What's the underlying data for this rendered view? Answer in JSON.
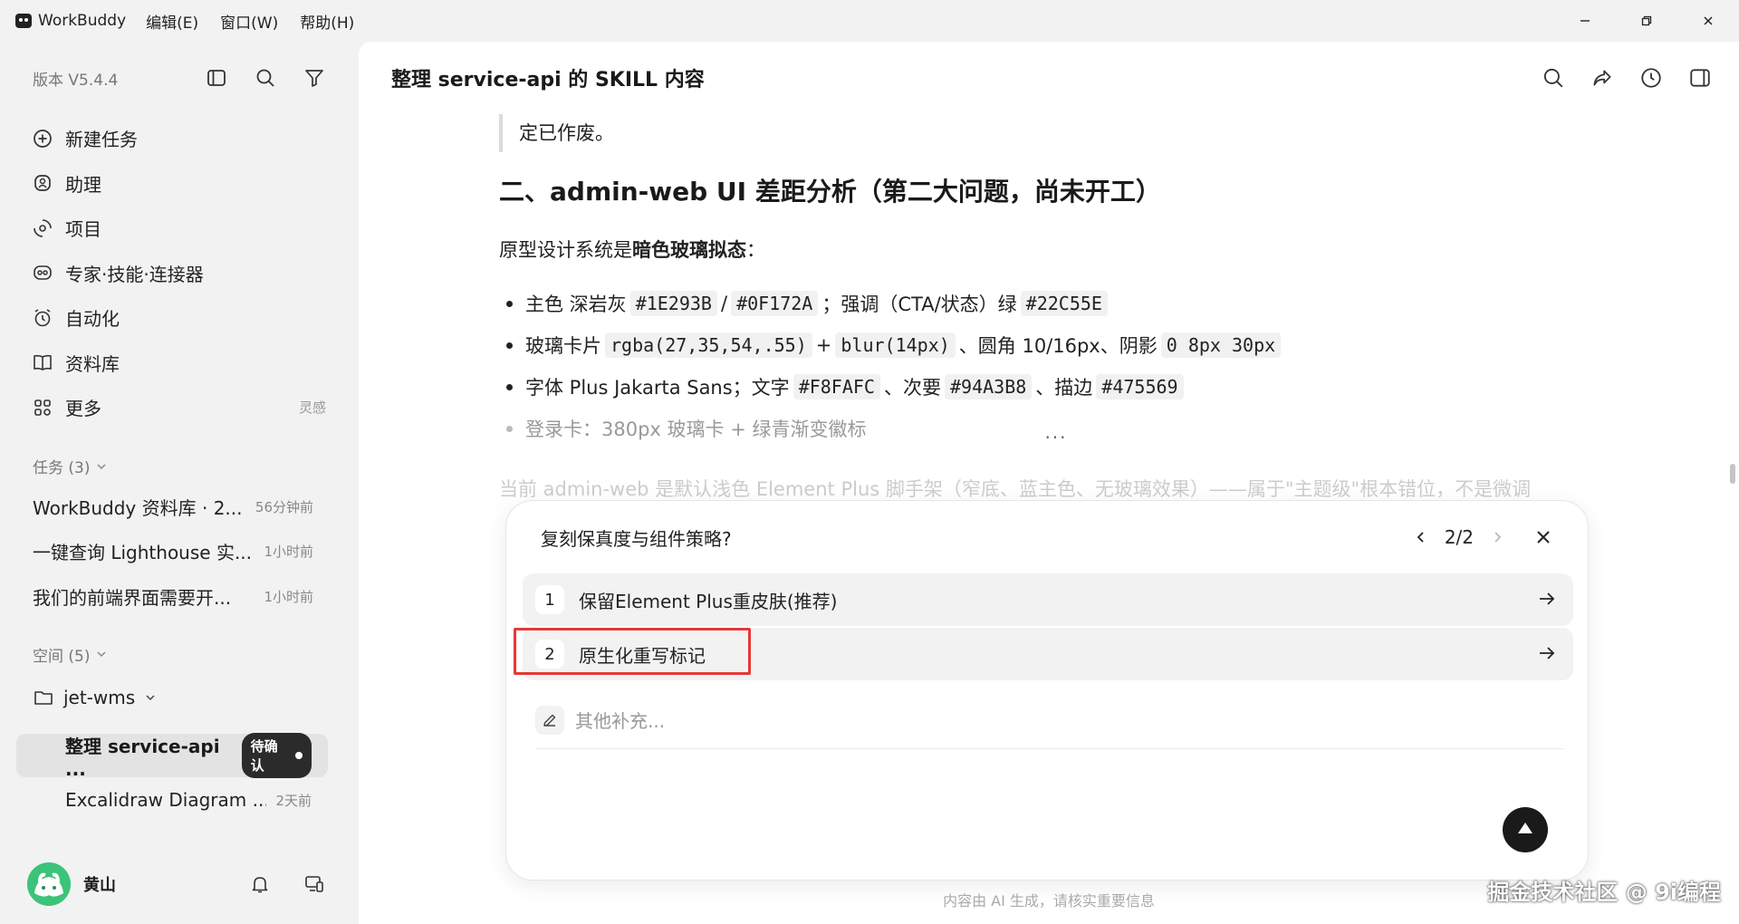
{
  "app": {
    "name": "WorkBuddy"
  },
  "menu": [
    "编辑(E)",
    "窗口(W)",
    "帮助(H)"
  ],
  "sidebar": {
    "version": "版本 V5.4.4",
    "nav": [
      {
        "label": "新建任务",
        "icon": "plus-circle-icon"
      },
      {
        "label": "助理",
        "icon": "assistant-icon"
      },
      {
        "label": "项目",
        "icon": "project-icon"
      },
      {
        "label": "专家·技能·连接器",
        "icon": "expert-icon"
      },
      {
        "label": "自动化",
        "icon": "alarm-clock-icon"
      },
      {
        "label": "资料库",
        "icon": "book-icon"
      },
      {
        "label": "更多",
        "icon": "grid-icon",
        "hint": "灵感"
      }
    ],
    "tasks_label": "任务 (3)",
    "tasks": [
      {
        "title": "WorkBuddy 资料库 · 2...",
        "time": "56分钟前"
      },
      {
        "title": "一键查询 Lighthouse 实...",
        "time": "1小时前"
      },
      {
        "title": "我们的前端界面需要开...",
        "time": "1小时前"
      }
    ],
    "spaces_label": "空间 (5)",
    "folder": "jet-wms",
    "active_task": {
      "title": "整理 service-api ...",
      "badge": "待确认"
    },
    "sub_task": {
      "title": "Excalidraw Diagram ...",
      "time": "2天前"
    },
    "user": {
      "name": "黄山"
    }
  },
  "main": {
    "title": "整理 service-api 的 SKILL 内容",
    "quote": "定已作废。",
    "heading": "二、admin-web UI 差距分析（第二大问题，尚未开工）",
    "para_prefix": "原型设计系统是",
    "para_bold": "暗色玻璃拟态",
    "para_suffix": "：",
    "bullet1": {
      "t1": "主色 深岩灰",
      "c1": "#1E293B",
      "t2": "/",
      "c2": "#0F172A",
      "t3": "；强调（CTA/状态）绿",
      "c3": "#22C55E"
    },
    "bullet2": {
      "t1": "玻璃卡片",
      "c1": "rgba(27,35,54,.55)",
      "t2": "+",
      "c2": "blur(14px)",
      "t3": "、圆角 10/16px、阴影",
      "c3": "0 8px 30px"
    },
    "bullet3": {
      "t1": "字体 Plus Jakarta Sans；文字",
      "c1": "#F8FAFC",
      "t2": "、次要",
      "c2": "#94A3B8",
      "t3": "、描边",
      "c3": "#475569"
    },
    "bullet4": "登录卡：380px 玻璃卡 + 绿青渐变徽标",
    "faded_line": "当前 admin-web 是默认浅色 Element Plus 脚手架（窄底、蓝主色、无玻璃效果）——属于\"主题级\"根本错位，不是微调",
    "more": "···"
  },
  "dialog": {
    "question": "复刻保真度与组件策略?",
    "pager": "2/2",
    "options": [
      {
        "num": "1",
        "label": "保留Element Plus重皮肤(推荐)"
      },
      {
        "num": "2",
        "label": "原生化重写标记"
      }
    ],
    "other_placeholder": "其他补充..."
  },
  "footer_note": "内容由 AI 生成，请核实重要信息",
  "watermark": "掘金技术社区 @ 9i编程"
}
